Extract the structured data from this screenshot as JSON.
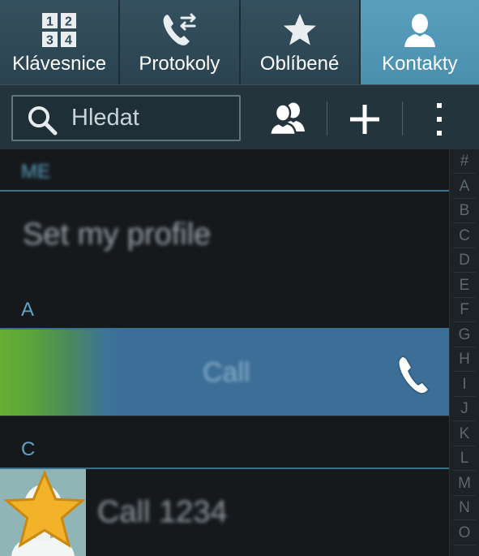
{
  "tabs": [
    {
      "id": "keypad",
      "label": "Klávesnice",
      "icon": "dialpad-icon",
      "active": false
    },
    {
      "id": "logs",
      "label": "Protokoly",
      "icon": "call-log-icon",
      "active": false
    },
    {
      "id": "favorites",
      "label": "Oblíbené",
      "icon": "star-icon",
      "active": false
    },
    {
      "id": "contacts",
      "label": "Kontakty",
      "icon": "person-icon",
      "active": true
    }
  ],
  "keypad_digits": [
    "1",
    "2",
    "3",
    "4"
  ],
  "search": {
    "placeholder": "Hledat",
    "value": ""
  },
  "toolbar": {
    "groups_icon": "groups-icon",
    "add_icon": "plus-icon",
    "menu_icon": "more-vertical-icon"
  },
  "sections": {
    "me": {
      "header": "ME",
      "row": "Set my profile"
    },
    "a": {
      "header": "A",
      "swipe_label": "Call",
      "swipe_icon": "phone-icon"
    },
    "c": {
      "header": "C",
      "row": "Call 1234",
      "favorite_icon": "star-icon"
    }
  },
  "index_letters": [
    "#",
    "A",
    "B",
    "C",
    "D",
    "E",
    "F",
    "G",
    "H",
    "I",
    "J",
    "K",
    "L",
    "M",
    "N",
    "O"
  ],
  "colors": {
    "tab_active": "#4a8fae",
    "tab_inactive": "#2c4553",
    "section_header": "#5fa3c6",
    "swipe_call_green": "#66ae34",
    "swipe_call_blue": "#3c6e97",
    "favorite_star": "#f2b32a"
  }
}
